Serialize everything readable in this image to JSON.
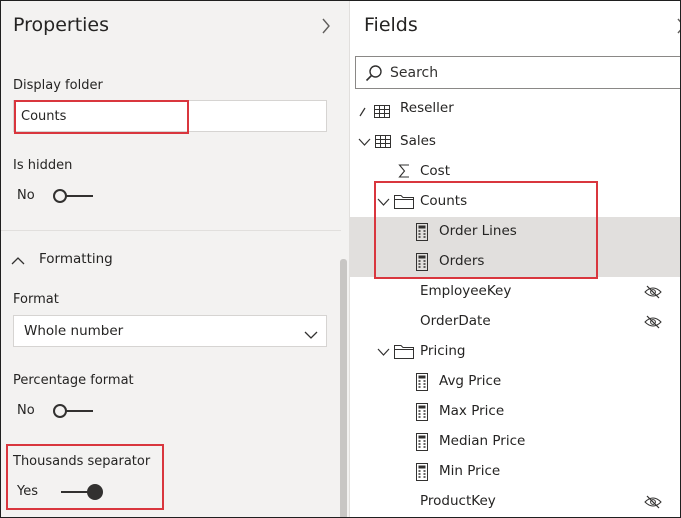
{
  "properties": {
    "title": "Properties",
    "display_folder": {
      "label": "Display folder",
      "value": "Counts"
    },
    "is_hidden": {
      "label": "Is hidden",
      "state_text": "No",
      "on": false
    },
    "formatting_section": {
      "label": "Formatting",
      "expanded": true
    },
    "format": {
      "label": "Format",
      "selected": "Whole number"
    },
    "percentage_format": {
      "label": "Percentage format",
      "state_text": "No",
      "on": false
    },
    "thousands_separator": {
      "label": "Thousands separator",
      "state_text": "Yes",
      "on": true
    }
  },
  "fields": {
    "title": "Fields",
    "search": {
      "placeholder": "Search"
    },
    "items": [
      {
        "label": "Reseller",
        "kind": "table",
        "expanded": false
      },
      {
        "label": "Sales",
        "kind": "table",
        "expanded": true
      },
      {
        "label": "Cost",
        "kind": "sum-field"
      },
      {
        "label": "Counts",
        "kind": "folder",
        "expanded": true
      },
      {
        "label": "Order Lines",
        "kind": "measure",
        "selected": true
      },
      {
        "label": "Orders",
        "kind": "measure",
        "selected": true
      },
      {
        "label": "EmployeeKey",
        "kind": "field",
        "hidden": true
      },
      {
        "label": "OrderDate",
        "kind": "field",
        "hidden": true
      },
      {
        "label": "Pricing",
        "kind": "folder",
        "expanded": true
      },
      {
        "label": "Avg Price",
        "kind": "measure"
      },
      {
        "label": "Max Price",
        "kind": "measure"
      },
      {
        "label": "Median Price",
        "kind": "measure"
      },
      {
        "label": "Min Price",
        "kind": "measure"
      },
      {
        "label": "ProductKey",
        "kind": "field",
        "hidden": true
      }
    ]
  },
  "colors": {
    "highlight": "#d9363e",
    "pane_bg": "#f3f2f1",
    "selected_row": "#e1dfdd"
  }
}
